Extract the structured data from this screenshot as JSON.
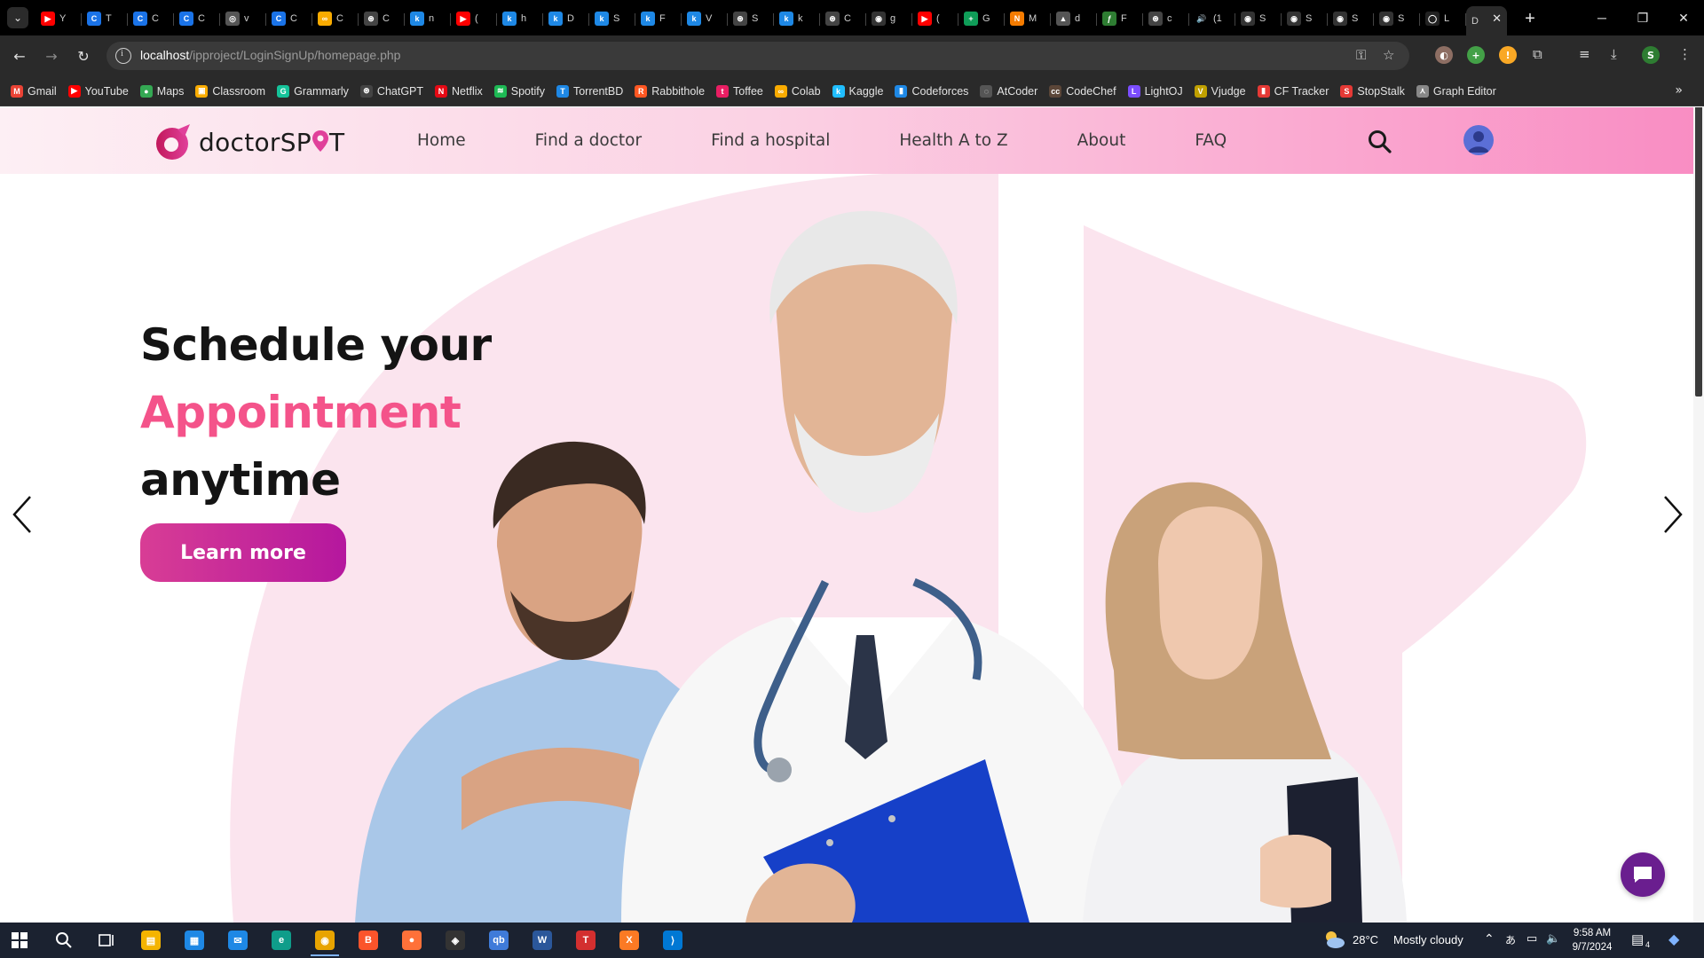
{
  "browser": {
    "tabs": [
      {
        "title": "Y",
        "color": "#ff0000",
        "glyph": "▶"
      },
      {
        "title": "T",
        "color": "#1a73e8",
        "glyph": "C"
      },
      {
        "title": "C",
        "color": "#1a73e8",
        "glyph": "C"
      },
      {
        "title": "C",
        "color": "#1a73e8",
        "glyph": "C"
      },
      {
        "title": "v",
        "color": "#555555",
        "glyph": "◎"
      },
      {
        "title": "C",
        "color": "#1a73e8",
        "glyph": "C"
      },
      {
        "title": "C",
        "color": "#f9ab00",
        "glyph": "∞"
      },
      {
        "title": "C",
        "color": "#444444",
        "glyph": "⊛"
      },
      {
        "title": "n",
        "color": "#1e88e5",
        "glyph": "k"
      },
      {
        "title": "(",
        "color": "#ff0000",
        "glyph": "▶"
      },
      {
        "title": "h",
        "color": "#1e88e5",
        "glyph": "k"
      },
      {
        "title": "D",
        "color": "#1e88e5",
        "glyph": "k"
      },
      {
        "title": "S",
        "color": "#1e88e5",
        "glyph": "k"
      },
      {
        "title": "F",
        "color": "#1e88e5",
        "glyph": "k"
      },
      {
        "title": "V",
        "color": "#1e88e5",
        "glyph": "k"
      },
      {
        "title": "S",
        "color": "#444444",
        "glyph": "⊛"
      },
      {
        "title": "k",
        "color": "#1e88e5",
        "glyph": "k"
      },
      {
        "title": "C",
        "color": "#444444",
        "glyph": "⊛"
      },
      {
        "title": "g",
        "color": "#333333",
        "glyph": "◉"
      },
      {
        "title": "(",
        "color": "#ff0000",
        "glyph": "▶"
      },
      {
        "title": "G",
        "color": "#0f9d58",
        "glyph": "+"
      },
      {
        "title": "M",
        "color": "#f57c00",
        "glyph": "N"
      },
      {
        "title": "d",
        "color": "#555555",
        "glyph": "▲"
      },
      {
        "title": "F",
        "color": "#2e7d32",
        "glyph": "ƒ"
      },
      {
        "title": "c",
        "color": "#444444",
        "glyph": "⊛"
      },
      {
        "title": "(1",
        "color": "#000000",
        "glyph": "🔊"
      },
      {
        "title": "S",
        "color": "#333333",
        "glyph": "◉"
      },
      {
        "title": "S",
        "color": "#333333",
        "glyph": "◉"
      },
      {
        "title": "S",
        "color": "#333333",
        "glyph": "◉"
      },
      {
        "title": "S",
        "color": "#333333",
        "glyph": "◉"
      },
      {
        "title": "L",
        "color": "#222222",
        "glyph": "◯"
      }
    ],
    "active_tab": {
      "title": "D",
      "close": "✕"
    },
    "new_tab": "+",
    "window_controls": {
      "minimize": "─",
      "restore": "❐",
      "close": "✕"
    },
    "url_host": "localhost",
    "url_path": "/ipproject/LoginSignUp/homepage.php",
    "profile_initial": "S",
    "bookmarks": [
      {
        "label": "Gmail",
        "color": "#ea4335",
        "glyph": "M"
      },
      {
        "label": "YouTube",
        "color": "#ff0000",
        "glyph": "▶"
      },
      {
        "label": "Maps",
        "color": "#34a853",
        "glyph": "●"
      },
      {
        "label": "Classroom",
        "color": "#f9ab00",
        "glyph": "▣"
      },
      {
        "label": "Grammarly",
        "color": "#15c39a",
        "glyph": "G"
      },
      {
        "label": "ChatGPT",
        "color": "#444444",
        "glyph": "⊛"
      },
      {
        "label": "Netflix",
        "color": "#e50914",
        "glyph": "N"
      },
      {
        "label": "Spotify",
        "color": "#1db954",
        "glyph": "≋"
      },
      {
        "label": "TorrentBD",
        "color": "#1e88e5",
        "glyph": "T"
      },
      {
        "label": "Rabbithole",
        "color": "#ff5722",
        "glyph": "R"
      },
      {
        "label": "Toffee",
        "color": "#e91e63",
        "glyph": "t"
      },
      {
        "label": "Colab",
        "color": "#f9ab00",
        "glyph": "∞"
      },
      {
        "label": "Kaggle",
        "color": "#20beff",
        "glyph": "k"
      },
      {
        "label": "Codeforces",
        "color": "#1e88e5",
        "glyph": "▮"
      },
      {
        "label": "AtCoder",
        "color": "#555555",
        "glyph": "◌"
      },
      {
        "label": "CodeChef",
        "color": "#5b4638",
        "glyph": "cc"
      },
      {
        "label": "LightOJ",
        "color": "#7b4dff",
        "glyph": "L"
      },
      {
        "label": "Vjudge",
        "color": "#c0a000",
        "glyph": "V"
      },
      {
        "label": "CF Tracker",
        "color": "#e53935",
        "glyph": "▮"
      },
      {
        "label": "StopStalk",
        "color": "#e53935",
        "glyph": "S"
      },
      {
        "label": "Graph Editor",
        "color": "#888888",
        "glyph": "⋏"
      }
    ],
    "bookmarks_more": "»"
  },
  "site": {
    "logo_text_pre": "doctorSP",
    "logo_text_post": "T",
    "nav": [
      "Home",
      "Find a doctor",
      "Find a hospital",
      "Health A to Z",
      "About",
      "FAQ"
    ],
    "colors": {
      "accent": "#f4538a",
      "button_start": "#d83d95",
      "button_end": "#b5179e",
      "chat": "#6a1e8f",
      "blob": "#fbe4ee"
    }
  },
  "hero": {
    "line1": "Schedule your",
    "line2": "Appointment",
    "line3": "anytime",
    "cta": "Learn more"
  },
  "taskbar": {
    "apps": [
      {
        "name": "File Explorer",
        "color": "#f4b400",
        "glyph": "▤"
      },
      {
        "name": "Microsoft Store",
        "color": "#1e88e5",
        "glyph": "▦"
      },
      {
        "name": "Mail",
        "color": "#1e88e5",
        "glyph": "✉"
      },
      {
        "name": "Edge",
        "color": "#0f9d8a",
        "glyph": "e"
      },
      {
        "name": "Chrome",
        "color": "#e8a400",
        "glyph": "◉"
      },
      {
        "name": "Brave",
        "color": "#fb542b",
        "glyph": "B"
      },
      {
        "name": "Firefox",
        "color": "#ff7139",
        "glyph": "●"
      },
      {
        "name": "App",
        "color": "#333333",
        "glyph": "◈"
      },
      {
        "name": "qBittorrent",
        "color": "#3f7bd9",
        "glyph": "qb"
      },
      {
        "name": "Word",
        "color": "#2b579a",
        "glyph": "W"
      },
      {
        "name": "App",
        "color": "#d32f2f",
        "glyph": "T"
      },
      {
        "name": "XAMPP",
        "color": "#fb7a24",
        "glyph": "X"
      },
      {
        "name": "VS Code",
        "color": "#0078d4",
        "glyph": "⟩"
      }
    ],
    "weather_temp": "28°C",
    "weather_text": "Mostly cloudy",
    "time": "9:58 AM",
    "date": "9/7/2024",
    "notifications": "4"
  }
}
